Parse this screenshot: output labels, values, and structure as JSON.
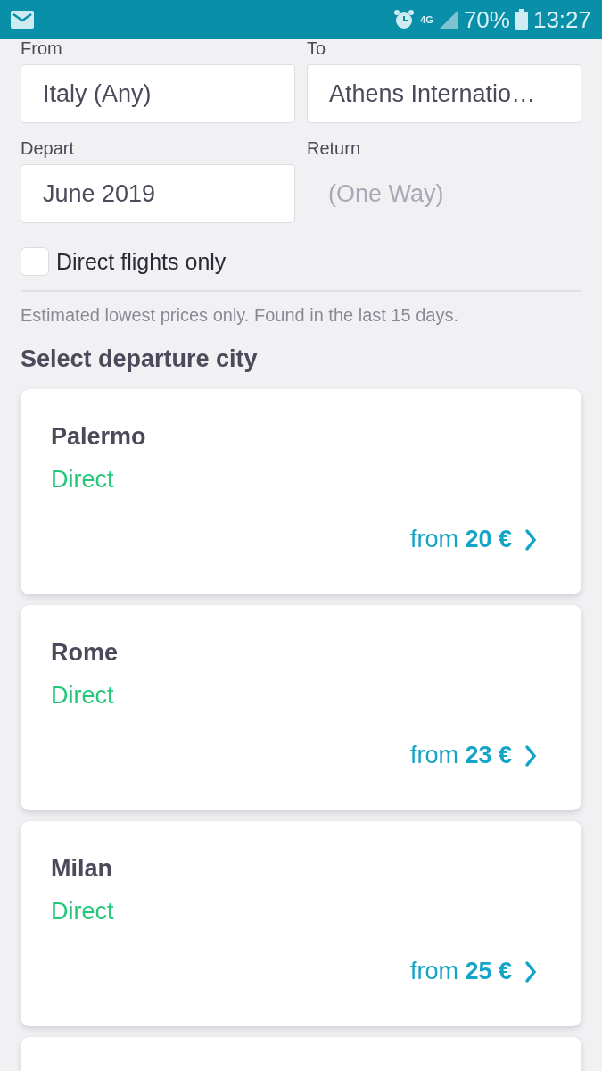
{
  "status_bar": {
    "network": "4G",
    "battery": "70%",
    "time": "13:27"
  },
  "from": {
    "label": "From",
    "value": "Italy (Any)"
  },
  "to": {
    "label": "To",
    "value": "Athens Internatio…"
  },
  "depart": {
    "label": "Depart",
    "value": "June 2019"
  },
  "return": {
    "label": "Return",
    "placeholder": "(One Way)"
  },
  "direct_only": {
    "label": "Direct flights only",
    "checked": false
  },
  "note": "Estimated lowest prices only. Found in the last 15 days.",
  "section_title": "Select departure city",
  "cities": [
    {
      "name": "Palermo",
      "stops": "Direct",
      "price": "from **20 €**"
    },
    {
      "name": "Rome",
      "stops": "Direct",
      "price": "from **23 €**"
    },
    {
      "name": "Milan",
      "stops": "Direct",
      "price": "from **25 €**"
    }
  ]
}
